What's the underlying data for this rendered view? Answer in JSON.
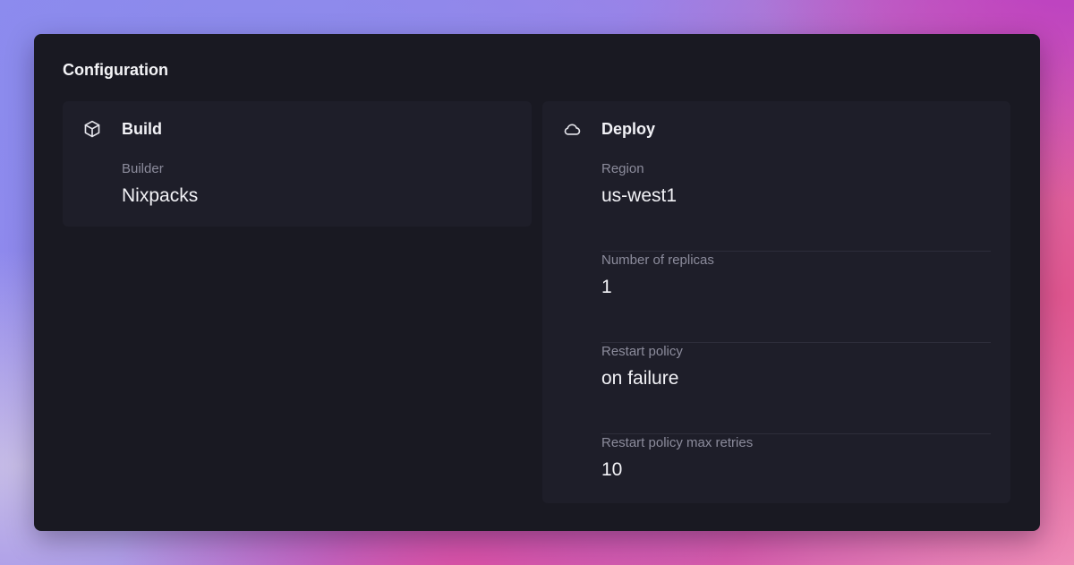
{
  "configuration": {
    "title": "Configuration",
    "build": {
      "title": "Build",
      "icon": "cube-icon",
      "fields": [
        {
          "label": "Builder",
          "value": "Nixpacks"
        }
      ]
    },
    "deploy": {
      "title": "Deploy",
      "icon": "cloud-icon",
      "fields": [
        {
          "label": "Region",
          "value": "us-west1"
        },
        {
          "label": "Number of replicas",
          "value": "1"
        },
        {
          "label": "Restart policy",
          "value": "on failure"
        },
        {
          "label": "Restart policy max retries",
          "value": "10"
        }
      ]
    }
  },
  "colors": {
    "card_background": "#191922",
    "panel_background": "#1e1e29",
    "label_text": "#8c8c9c",
    "value_text": "#f2f2f6"
  }
}
